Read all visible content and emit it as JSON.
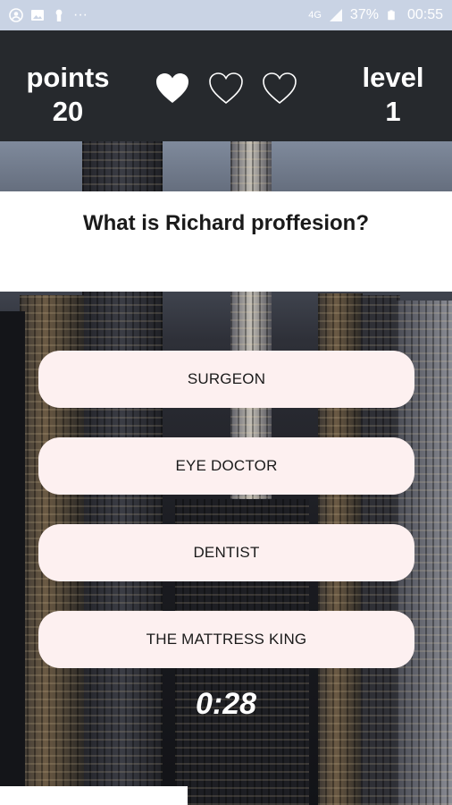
{
  "status_bar": {
    "left_icons": [
      "account-circle-icon",
      "image-icon",
      "keyhole-icon",
      "more-dots-icon"
    ],
    "more": "···",
    "network": "4G",
    "battery": "37%",
    "time": "00:55"
  },
  "header": {
    "points_label": "points",
    "points_value": "20",
    "level_label": "level",
    "level_value": "1",
    "lives": [
      {
        "state": "filled"
      },
      {
        "state": "empty"
      },
      {
        "state": "empty"
      }
    ]
  },
  "question": {
    "text": "What is Richard proffesion?"
  },
  "answers": [
    {
      "label": "SURGEON"
    },
    {
      "label": "EYE DOCTOR"
    },
    {
      "label": "DENTIST"
    },
    {
      "label": "THE MATTRESS KING"
    }
  ],
  "timer": "0:28",
  "colors": {
    "header_bg": "#26292d",
    "answer_bg": "#fdf0f0",
    "status_bar_bg": "#c9d3e4"
  }
}
